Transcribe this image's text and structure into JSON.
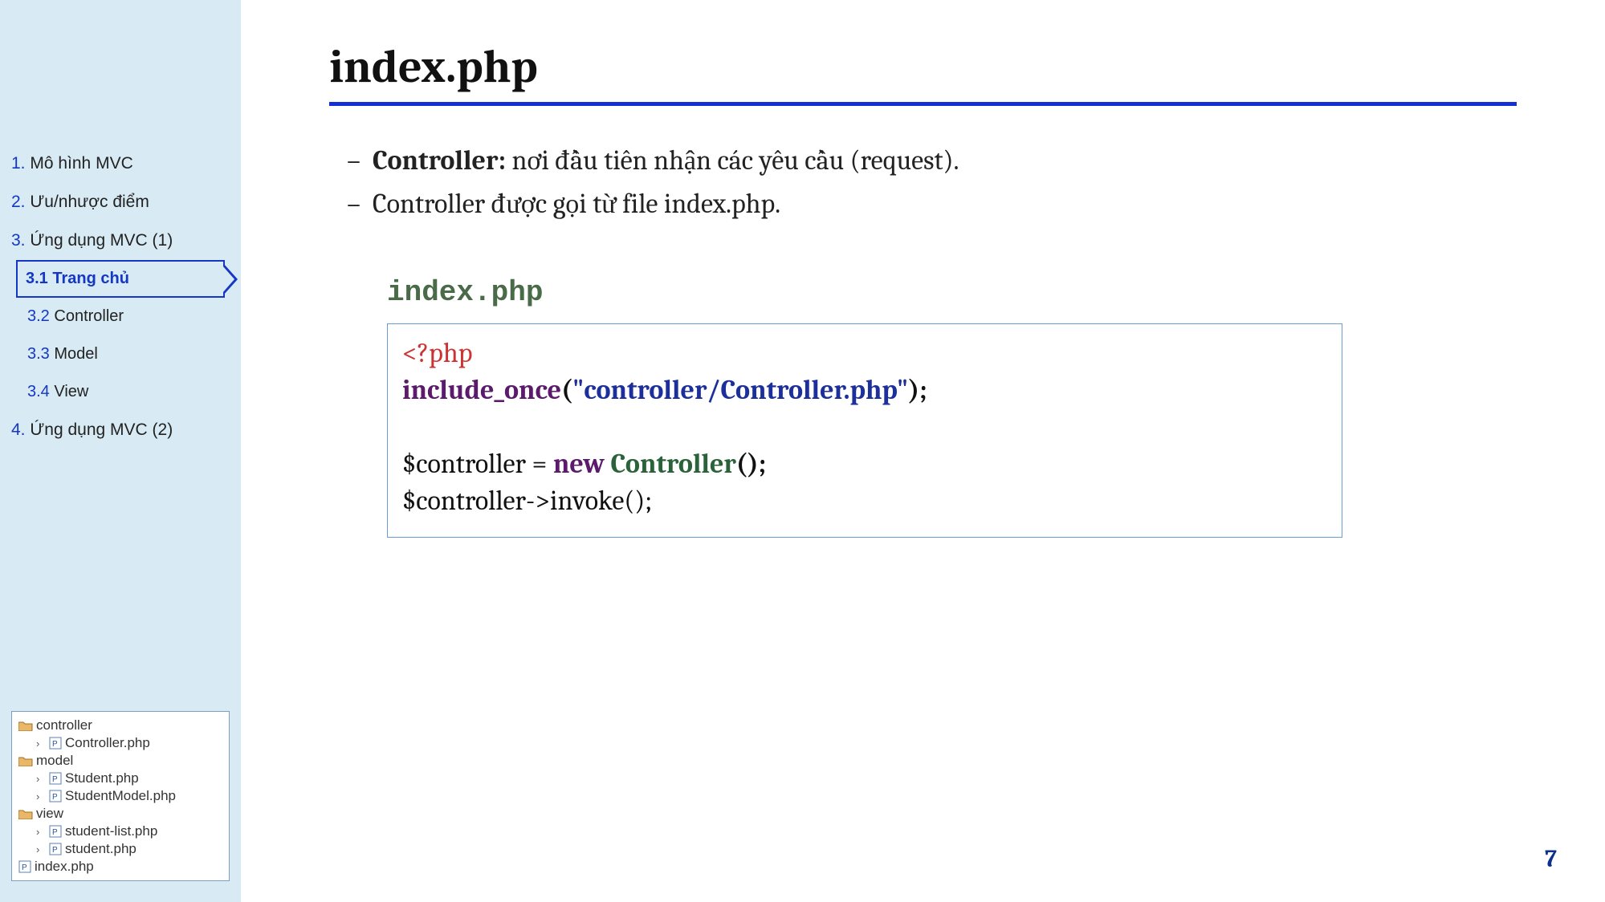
{
  "sidebar": {
    "toc": [
      {
        "num": "1.",
        "label": "Mô hình MVC"
      },
      {
        "num": "2.",
        "label": "Ưu/nhược điểm"
      },
      {
        "num": "3.",
        "label": "Ứng dụng MVC (1)"
      }
    ],
    "sub": [
      {
        "num": "3.1",
        "label": "Trang chủ",
        "active": true
      },
      {
        "num": "3.2",
        "label": "Controller",
        "active": false
      },
      {
        "num": "3.3",
        "label": "Model",
        "active": false
      },
      {
        "num": "3.4",
        "label": "View",
        "active": false
      }
    ],
    "toc_after": [
      {
        "num": "4.",
        "label": "Ứng dụng MVC (2)"
      }
    ]
  },
  "filetree": {
    "folders": [
      {
        "name": "controller",
        "files": [
          "Controller.php"
        ]
      },
      {
        "name": "model",
        "files": [
          "Student.php",
          "StudentModel.php"
        ]
      },
      {
        "name": "view",
        "files": [
          "student-list.php",
          "student.php"
        ]
      }
    ],
    "root_files": [
      "index.php"
    ]
  },
  "main": {
    "title": "index.php",
    "bullets": [
      {
        "bold": "Controller:",
        "text": " nơi đầu tiên nhận các yêu cầu (request)."
      },
      {
        "bold": "",
        "text": "Controller được gọi từ file index.php."
      }
    ],
    "code_label": "index.php",
    "code": {
      "open": "<?php",
      "include_kw": "include_once",
      "include_arg": "\"controller/Controller.php\"",
      "new_kw": "new",
      "cls": "Controller",
      "line_var": "$controller = ",
      "line_invoke": "$controller->invoke();",
      "paren_open": "(",
      "paren_close": ");",
      "paren_close2": "();"
    },
    "page_number": "7"
  }
}
